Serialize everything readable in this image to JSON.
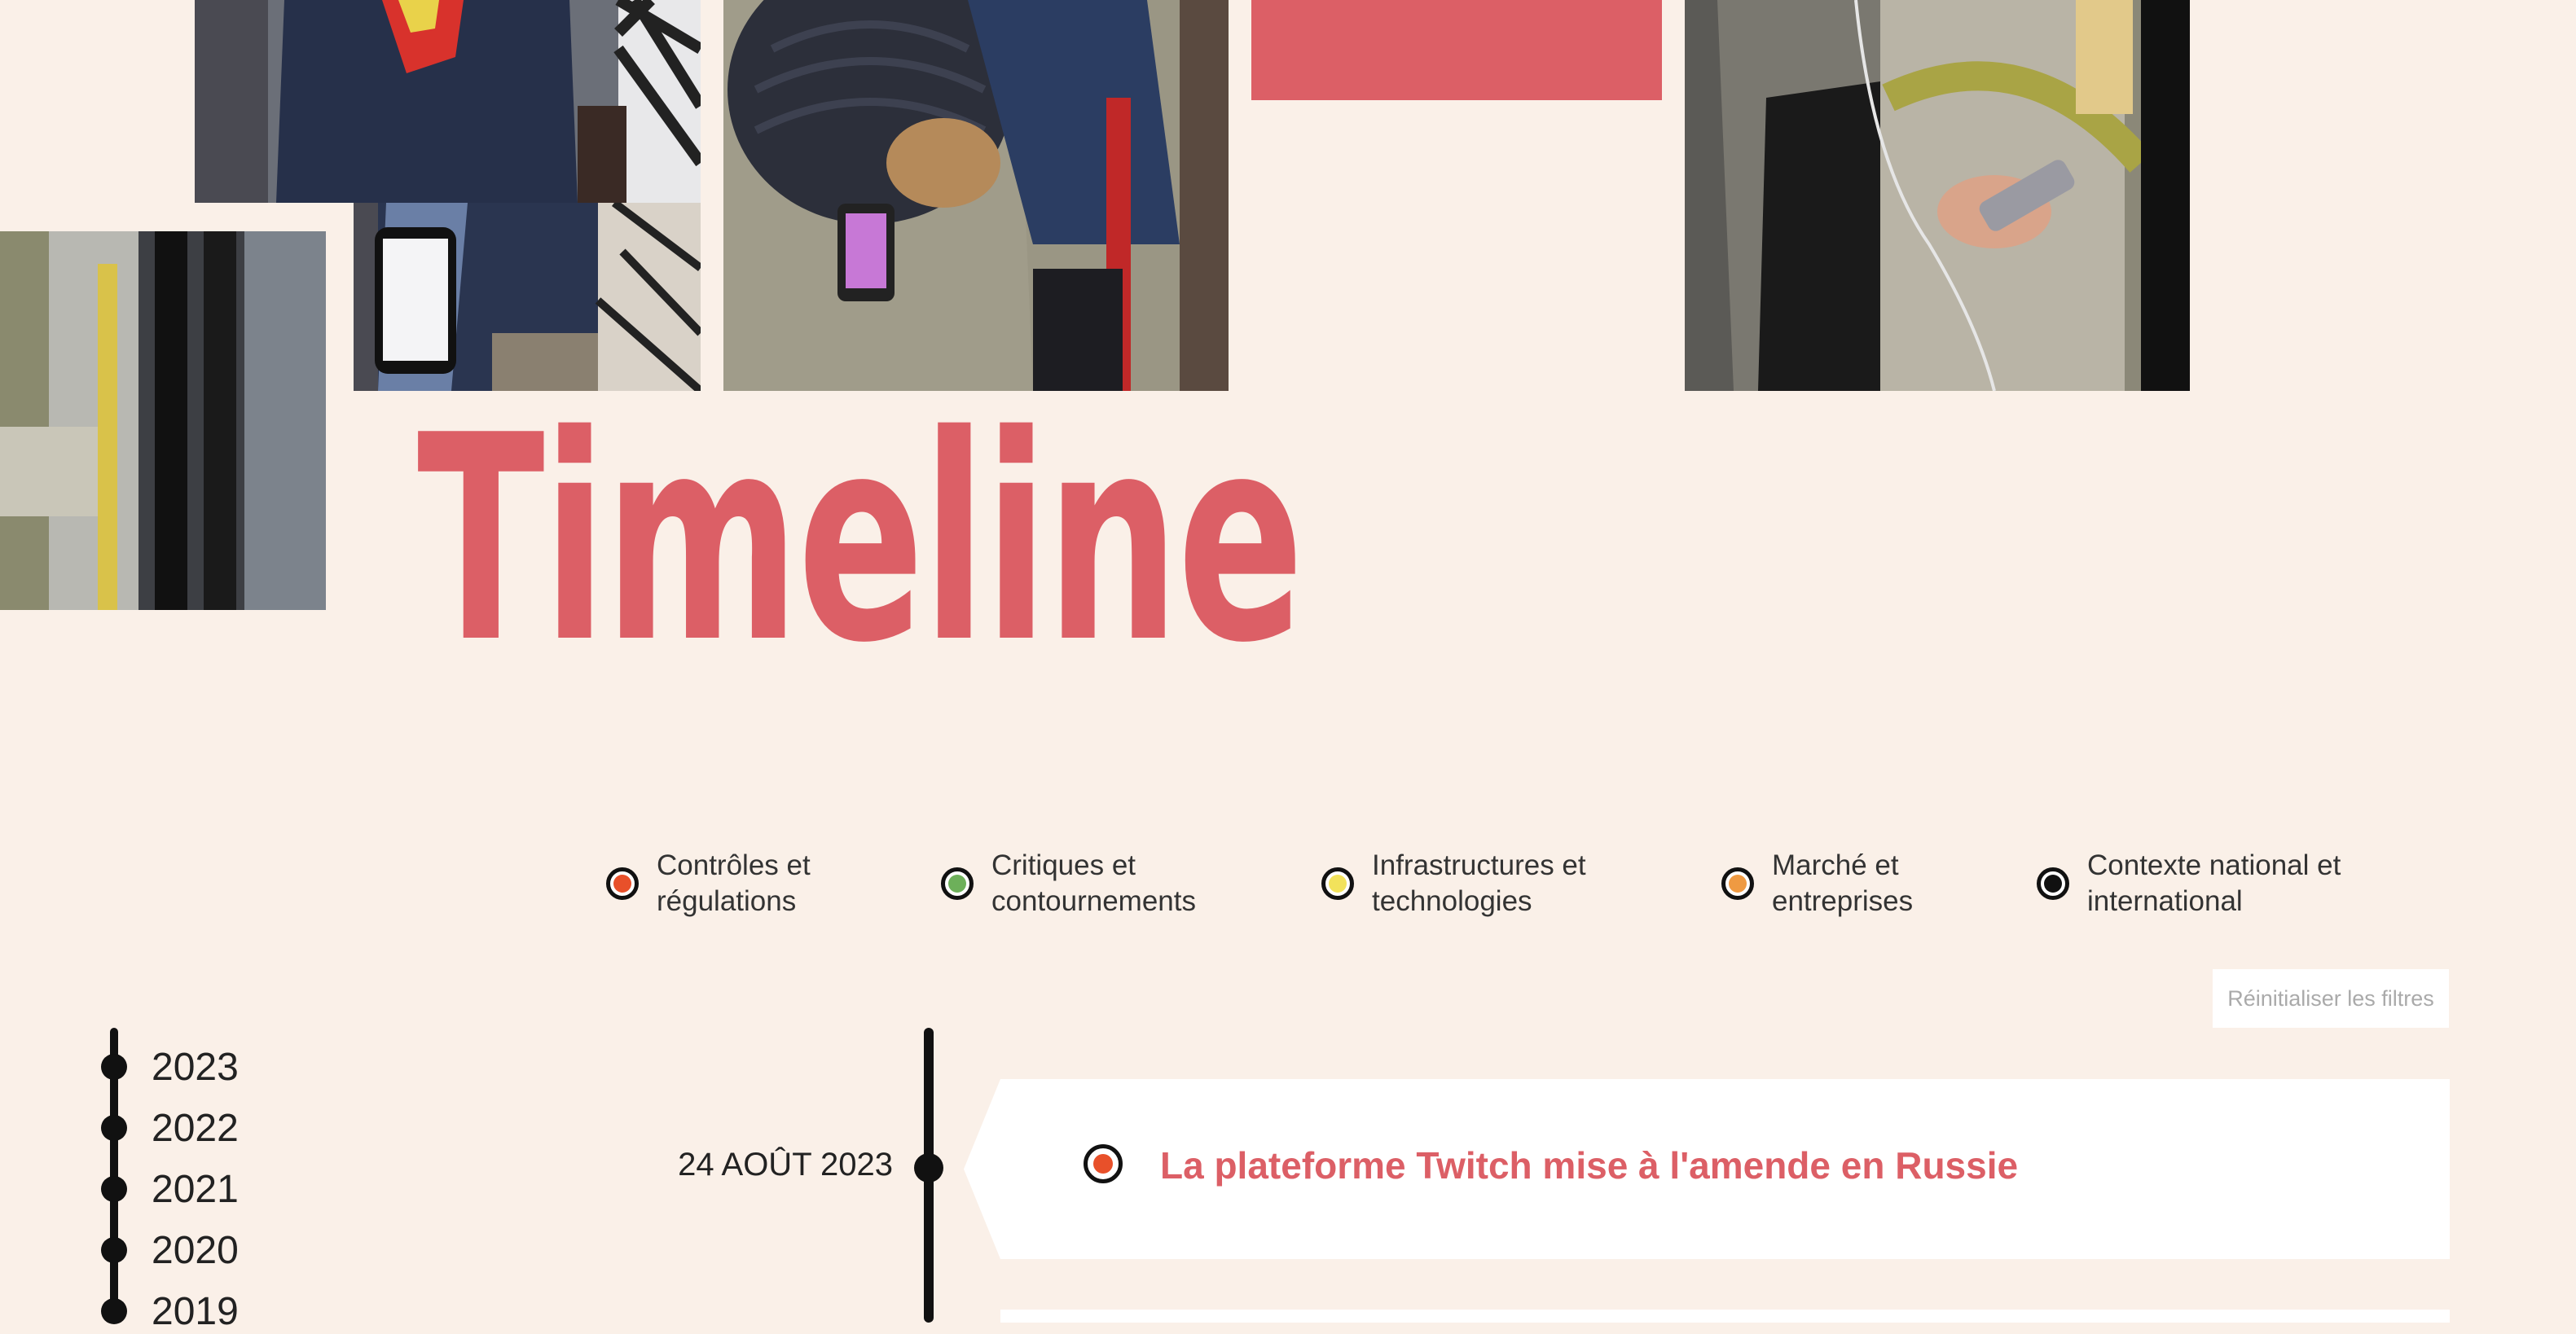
{
  "title": "Timeline",
  "legend": [
    {
      "label": "Contrôles et\nrégulations",
      "color": "#e8502a"
    },
    {
      "label": "Critiques et\ncontournements",
      "color": "#6db05a"
    },
    {
      "label": "Infrastructures et\ntechnologies",
      "color": "#f2e25b"
    },
    {
      "label": "Marché et\nentreprises",
      "color": "#ef9a42"
    },
    {
      "label": "Contexte national et\ninternational",
      "color": "#111111"
    }
  ],
  "reset_label": "Réinitialiser les filtres",
  "years": [
    "2023",
    "2022",
    "2021",
    "2020",
    "2019"
  ],
  "event": {
    "date": "24 AOÛT 2023",
    "title": "La plateforme Twitch mise à l'amende en Russie",
    "category_color": "#e8502a"
  },
  "colors": {
    "accent": "#dc5f66",
    "background": "#faf0e8"
  }
}
